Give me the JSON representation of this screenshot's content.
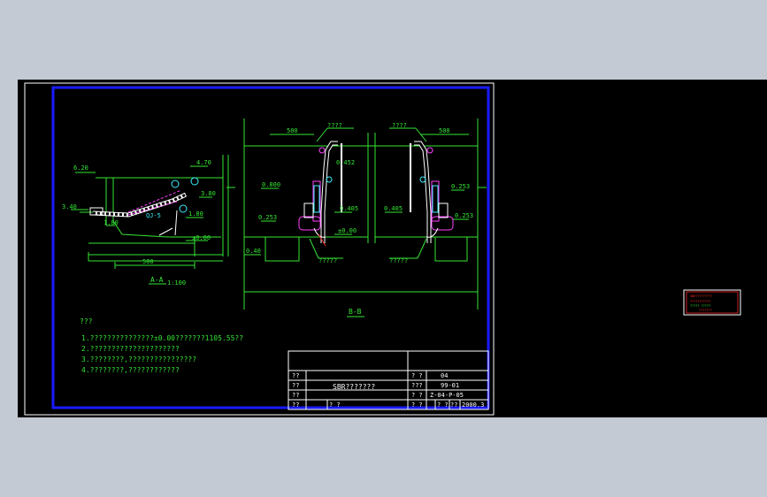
{
  "section_aa": {
    "elevations": [
      "6.20",
      "4.70",
      "3.80",
      "3.40",
      "1.80",
      "1.80",
      "±0.00"
    ],
    "dimension": "500",
    "pump_label": "QJ-5",
    "title": "A-A",
    "scale": "1:100"
  },
  "section_bb": {
    "left_panel": {
      "callout_top": "????",
      "dimension": "500",
      "elevations": [
        "0.800",
        "0.452",
        "0.405",
        "0.253",
        "±0.00",
        "0.40"
      ],
      "callout_bottom": "?????"
    },
    "right_panel": {
      "callout_top": "????",
      "dimension": "500",
      "elevations": [
        "0.253",
        "0.405",
        "0.253"
      ],
      "callout_bottom": "?????"
    },
    "title": "B-B"
  },
  "notes": {
    "heading": "???",
    "lines": [
      "1.???????????????±0.00???????1105.55??",
      "2.?????????????????????",
      "3.????????,????????????????",
      "4.????????,????????????"
    ]
  },
  "title_block": {
    "drawing_name": "SBR???????",
    "r1": [
      "??",
      "?  ?",
      "04"
    ],
    "r2": [
      "??",
      "???",
      "99-01"
    ],
    "r3": [
      "??",
      "?  ?",
      "Z-04-P-05"
    ],
    "r4": [
      "??",
      "?  ?",
      "?  ?",
      "?  ?",
      "??",
      "2000.3"
    ]
  },
  "thumbnail": {
    "lines": [
      "SBR?????????",
      "???????????",
      "?????  ?????",
      "???????"
    ]
  },
  "colors": {
    "green": "#34e634",
    "cyan": "#3cf0ff",
    "magenta": "#ff40ff",
    "white": "#ffffff",
    "blue": "#1a1aff",
    "red": "#ff2a2a",
    "yellow": "#ffff40"
  }
}
